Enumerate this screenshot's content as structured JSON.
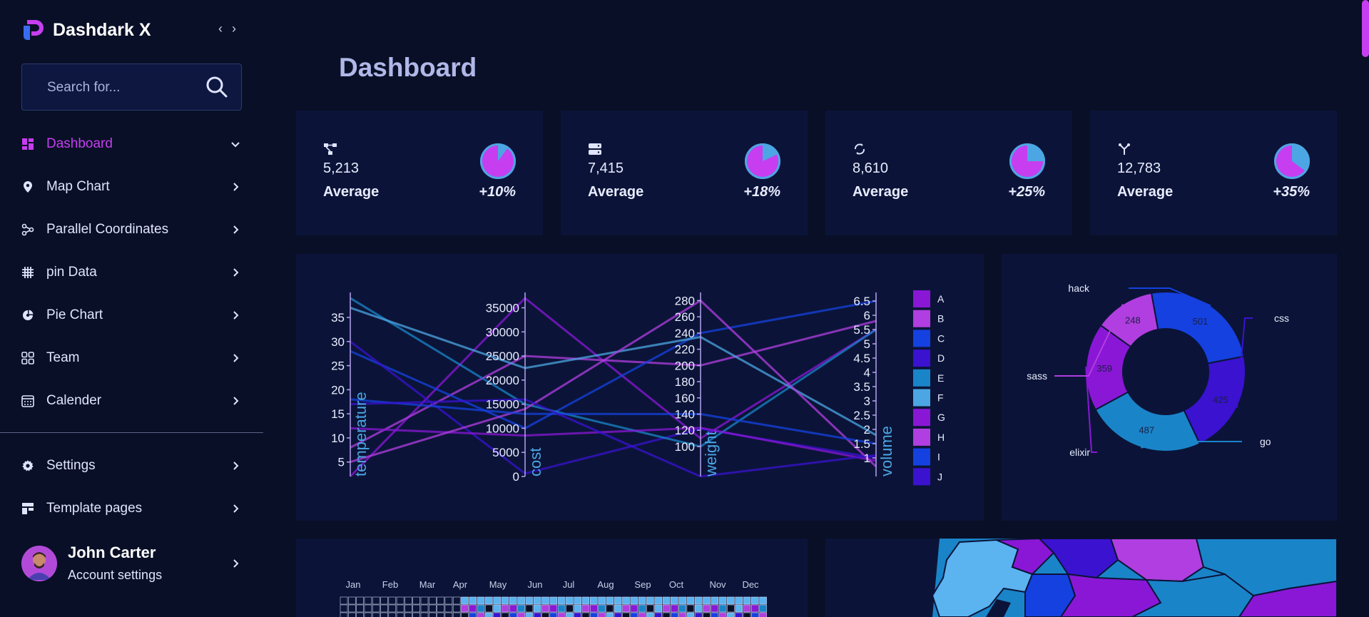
{
  "brand": {
    "name": "Dashdark X",
    "accent": "#c63ef0"
  },
  "search": {
    "placeholder": "Search for..."
  },
  "nav": [
    {
      "label": "Dashboard",
      "icon": "grid-icon",
      "active": true
    },
    {
      "label": "Map Chart",
      "icon": "pin-icon"
    },
    {
      "label": "Parallel Coordinates",
      "icon": "nodes-icon"
    },
    {
      "label": "pin Data",
      "icon": "hash-grid-icon"
    },
    {
      "label": "Pie Chart",
      "icon": "pie-icon"
    },
    {
      "label": "Team",
      "icon": "team-icon"
    },
    {
      "label": "Calender",
      "icon": "calendar-icon"
    }
  ],
  "nav_bottom": [
    {
      "label": "Settings",
      "icon": "gear-icon"
    },
    {
      "label": "Template pages",
      "icon": "template-icon"
    }
  ],
  "user": {
    "name": "John Carter",
    "subtitle": "Account settings"
  },
  "page": {
    "title": "Dashboard"
  },
  "stats": [
    {
      "icon": "network-icon",
      "value": "5,213",
      "label": "Average",
      "change": "+10%"
    },
    {
      "icon": "server-icon",
      "value": "7,415",
      "label": "Average",
      "change": "+18%"
    },
    {
      "icon": "sync-icon",
      "value": "8,610",
      "label": "Average",
      "change": "+25%"
    },
    {
      "icon": "branch-icon",
      "value": "12,783",
      "label": "Average",
      "change": "+35%"
    }
  ],
  "chart_data": [
    {
      "type": "parallel-coordinates",
      "axes": [
        {
          "label": "temperature",
          "ticks": [
            "5",
            "10",
            "15",
            "20",
            "25",
            "30",
            "35"
          ],
          "range": [
            2,
            39
          ]
        },
        {
          "label": "cost",
          "ticks": [
            "0",
            "5000",
            "10000",
            "15000",
            "20000",
            "25000",
            "30000",
            "35000"
          ],
          "range": [
            0,
            37000
          ]
        },
        {
          "label": "weight",
          "ticks": [
            "100",
            "120",
            "140",
            "160",
            "180",
            "200",
            "220",
            "240",
            "260",
            "280"
          ],
          "range": [
            63,
            283
          ]
        },
        {
          "label": "volume",
          "ticks": [
            "1",
            "1.5",
            "2",
            "2.5",
            "3",
            "3.5",
            "4",
            "4.5",
            "5",
            "5.5",
            "6",
            "6.5"
          ],
          "range": [
            0.35,
            6.6
          ]
        }
      ],
      "series": [
        {
          "name": "A",
          "color": "#8a17d6",
          "values": [
            2,
            37000,
            110,
            5.5
          ]
        },
        {
          "name": "B",
          "color": "#b13ee0",
          "values": [
            8,
            25000,
            200,
            5.8
          ]
        },
        {
          "name": "C",
          "color": "#1541e0",
          "values": [
            28,
            10000,
            240,
            6.5
          ]
        },
        {
          "name": "D",
          "color": "#3a12d0",
          "values": [
            30,
            600,
            122,
            1
          ]
        },
        {
          "name": "E",
          "color": "#1a84c9",
          "values": [
            39,
            15000,
            100,
            5.5
          ]
        },
        {
          "name": "F",
          "color": "#4ca6e3",
          "values": [
            37,
            22500,
            235,
            1.8
          ]
        },
        {
          "name": "G",
          "color": "#8a17d6",
          "values": [
            12,
            8500,
            123,
            0.9
          ]
        },
        {
          "name": "H",
          "color": "#b13ee0",
          "values": [
            5,
            14000,
            280,
            0.7
          ]
        },
        {
          "name": "I",
          "color": "#1541e0",
          "values": [
            18,
            13000,
            140,
            1.5
          ]
        },
        {
          "name": "J",
          "color": "#3a12d0",
          "values": [
            17,
            16000,
            63,
            1.1
          ]
        }
      ]
    },
    {
      "type": "pie",
      "labels": [
        "hack",
        "css",
        "go",
        "elixir",
        "sass"
      ],
      "values": [
        501,
        425,
        487,
        359,
        248
      ],
      "colors": [
        "#1541e0",
        "#3a12d0",
        "#1a84c9",
        "#8a17d6",
        "#b13ee0"
      ]
    },
    {
      "type": "heatmap",
      "months": [
        "Jan",
        "Feb",
        "Mar",
        "Apr",
        "May",
        "Jun",
        "Jul",
        "Aug",
        "Sep",
        "Oct",
        "Nov",
        "Dec"
      ]
    }
  ]
}
